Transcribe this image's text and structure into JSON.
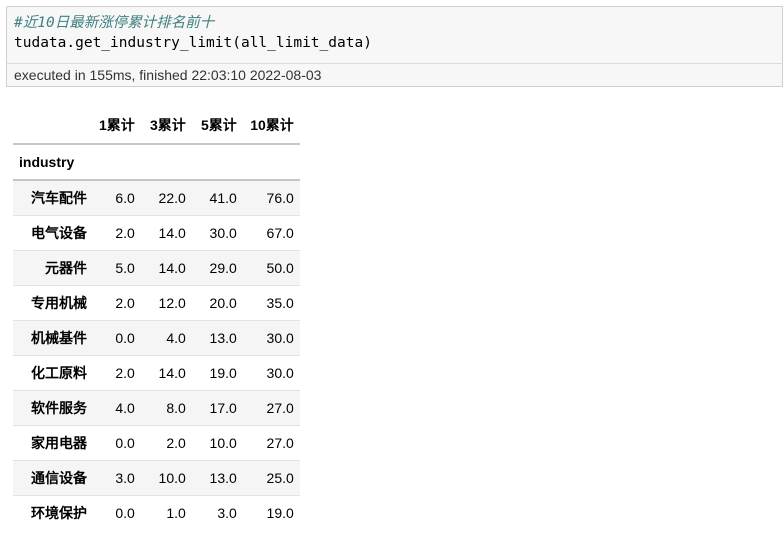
{
  "cell": {
    "comment": "#近10日最新涨停累计排名前十",
    "code": "tudata.get_industry_limit(all_limit_data)"
  },
  "exec_info": "executed in 155ms, finished 22:03:10 2022-08-03",
  "table": {
    "columns": [
      "1累计",
      "3累计",
      "5累计",
      "10累计"
    ],
    "index_name": "industry",
    "rows": [
      {
        "label": "汽车配件",
        "values": [
          "6.0",
          "22.0",
          "41.0",
          "76.0"
        ]
      },
      {
        "label": "电气设备",
        "values": [
          "2.0",
          "14.0",
          "30.0",
          "67.0"
        ]
      },
      {
        "label": "元器件",
        "values": [
          "5.0",
          "14.0",
          "29.0",
          "50.0"
        ]
      },
      {
        "label": "专用机械",
        "values": [
          "2.0",
          "12.0",
          "20.0",
          "35.0"
        ]
      },
      {
        "label": "机械基件",
        "values": [
          "0.0",
          "4.0",
          "13.0",
          "30.0"
        ]
      },
      {
        "label": "化工原料",
        "values": [
          "2.0",
          "14.0",
          "19.0",
          "30.0"
        ]
      },
      {
        "label": "软件服务",
        "values": [
          "4.0",
          "8.0",
          "17.0",
          "27.0"
        ]
      },
      {
        "label": "家用电器",
        "values": [
          "0.0",
          "2.0",
          "10.0",
          "27.0"
        ]
      },
      {
        "label": "通信设备",
        "values": [
          "3.0",
          "10.0",
          "13.0",
          "25.0"
        ]
      },
      {
        "label": "环境保护",
        "values": [
          "0.0",
          "1.0",
          "3.0",
          "19.0"
        ]
      }
    ]
  }
}
